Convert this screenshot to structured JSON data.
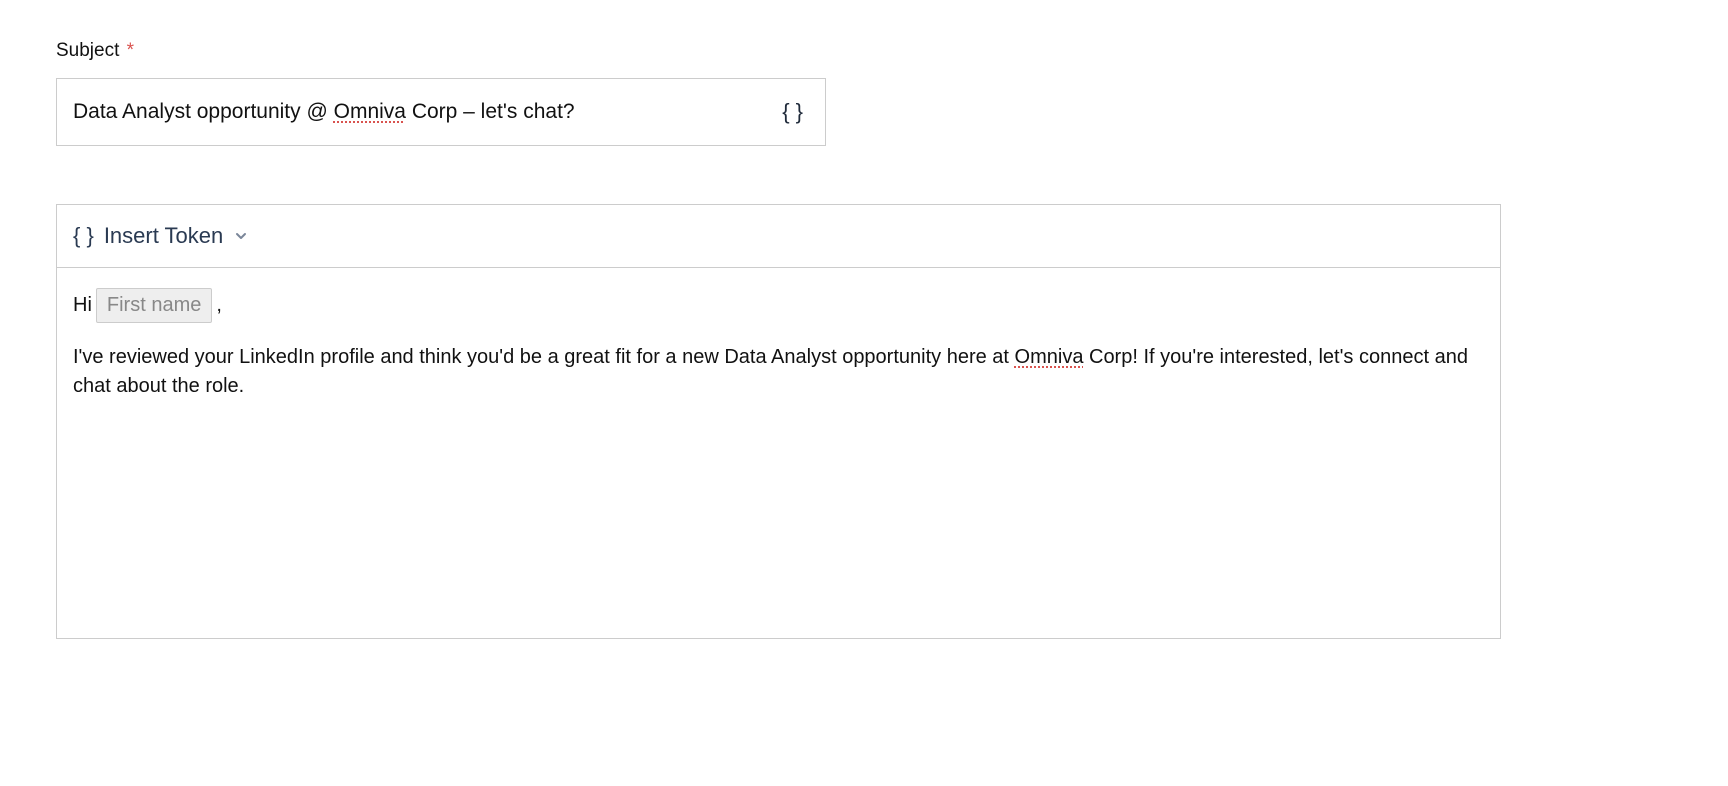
{
  "subject": {
    "label": "Subject",
    "required_mark": "*",
    "value_pre": "Data Analyst opportunity @ ",
    "value_spell": "Omniva",
    "value_post": " Corp – let's chat?",
    "braces_symbol": "{ }"
  },
  "editor": {
    "insert_token": {
      "braces_symbol": "{ }",
      "label": "Insert Token"
    },
    "greeting": {
      "hi": "Hi",
      "token": "First name",
      "comma": ","
    },
    "body": {
      "text_part1": "I've reviewed your LinkedIn profile and think you'd be a great fit for a new Data Analyst opportunity here at ",
      "spellword": "Omniva",
      "text_part2": " Corp! If you're interested, let's connect and chat about the role."
    }
  }
}
